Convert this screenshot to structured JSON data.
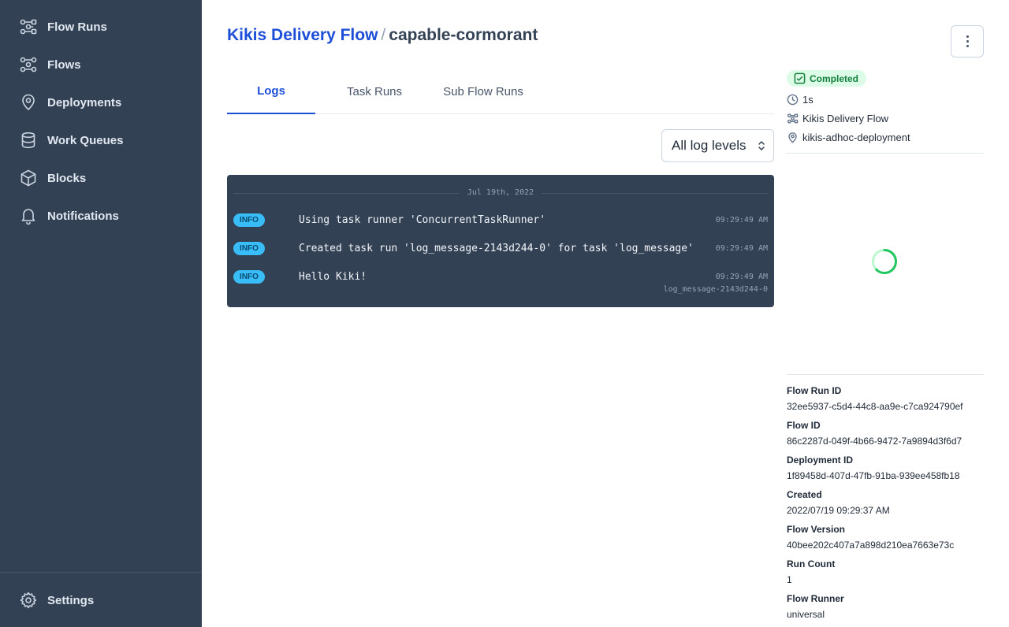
{
  "sidebar": {
    "items": [
      {
        "label": "Flow Runs",
        "icon": "flow-runs-icon"
      },
      {
        "label": "Flows",
        "icon": "flows-icon"
      },
      {
        "label": "Deployments",
        "icon": "map-pin-icon"
      },
      {
        "label": "Work Queues",
        "icon": "database-icon"
      },
      {
        "label": "Blocks",
        "icon": "cube-icon"
      },
      {
        "label": "Notifications",
        "icon": "bell-icon"
      }
    ],
    "settings_label": "Settings"
  },
  "breadcrumb": {
    "flow_name": "Kikis Delivery Flow",
    "separator": "/",
    "run_name": "capable-cormorant"
  },
  "tabs": [
    {
      "label": "Logs",
      "active": true
    },
    {
      "label": "Task Runs",
      "active": false
    },
    {
      "label": "Sub Flow Runs",
      "active": false
    }
  ],
  "log_filter": {
    "selected": "All log levels"
  },
  "logs": {
    "date": "Jul 19th, 2022",
    "entries": [
      {
        "level": "INFO",
        "message": "Using task runner 'ConcurrentTaskRunner'",
        "time": "09:29:49 AM",
        "task": ""
      },
      {
        "level": "INFO",
        "message": "Created task run 'log_message-2143d244-0' for task 'log_message'",
        "time": "09:29:49 AM",
        "task": ""
      },
      {
        "level": "INFO",
        "message": "Hello Kiki!",
        "time": "09:29:49 AM",
        "task": "log_message-2143d244-0"
      }
    ]
  },
  "details": {
    "status": "Completed",
    "duration": "1s",
    "flow": "Kikis Delivery Flow",
    "deployment": "kikis-adhoc-deployment"
  },
  "properties": [
    {
      "label": "Flow Run ID",
      "value": "32ee5937-c5d4-44c8-aa9e-c7ca924790ef"
    },
    {
      "label": "Flow ID",
      "value": "86c2287d-049f-4b66-9472-7a9894d3f6d7"
    },
    {
      "label": "Deployment ID",
      "value": "1f89458d-407d-47fb-91ba-939ee458fb18"
    },
    {
      "label": "Created",
      "value": "2022/07/19 09:29:37 AM"
    },
    {
      "label": "Flow Version",
      "value": "40bee202c407a7a898d210ea7663e73c"
    },
    {
      "label": "Run Count",
      "value": "1"
    },
    {
      "label": "Flow Runner",
      "value": "universal"
    }
  ],
  "colors": {
    "sidebar_bg": "#334155",
    "accent": "#1d4ed8",
    "success": "#15803d",
    "info_badge": "#38bdf8",
    "spinner": "#22c55e"
  }
}
